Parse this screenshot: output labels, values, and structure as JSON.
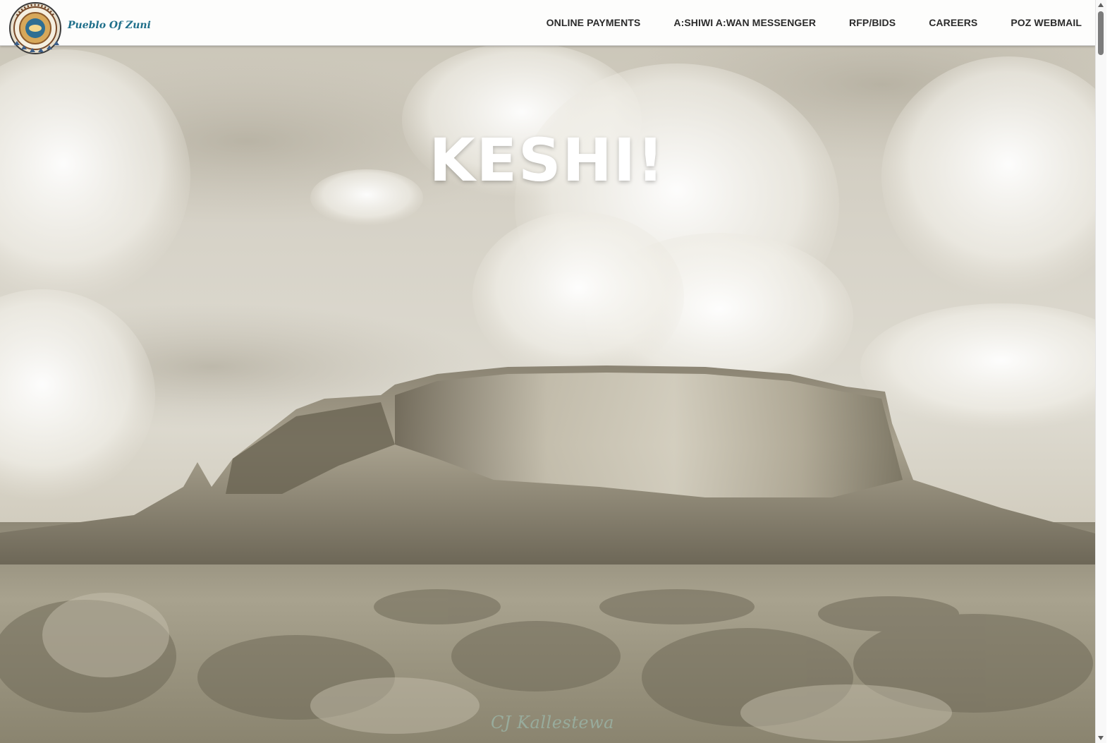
{
  "header": {
    "brand": "Pueblo Of Zuni",
    "logo_icon": "pueblo-of-zuni-seal-icon",
    "nav": [
      {
        "label": "ONLINE PAYMENTS"
      },
      {
        "label": "A:SHIWI A:WAN MESSENGER"
      },
      {
        "label": "RFP/BIDS"
      },
      {
        "label": "CAREERS"
      },
      {
        "label": "POZ WEBMAIL"
      }
    ]
  },
  "hero": {
    "title": "KESHI!",
    "signature": "CJ Kallestewa",
    "image": "sepia landscape photo"
  },
  "scrollbar": {
    "up_icon": "scroll-up-arrow-icon",
    "down_icon": "scroll-down-arrow-icon"
  },
  "colors": {
    "brand_text": "#1f6f8a",
    "nav_text": "#2b2b2b",
    "header_bg": "#fdfdfc",
    "hero_title": "#ffffff"
  }
}
